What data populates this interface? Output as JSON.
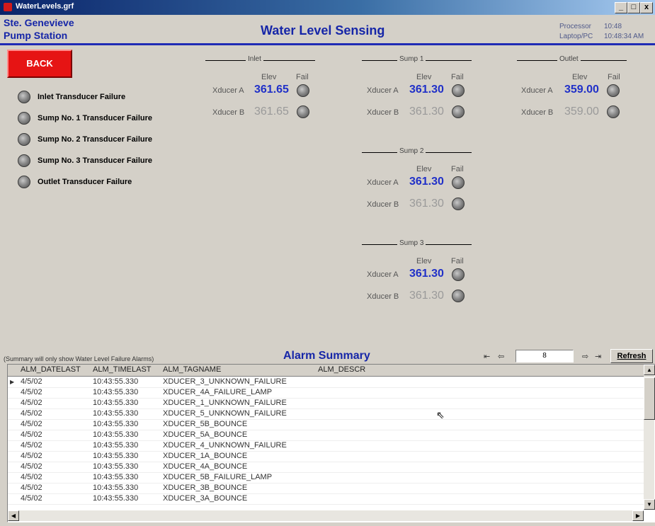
{
  "window": {
    "title": "WaterLevels.grf",
    "minimize": "_",
    "restore": "□",
    "close": "x"
  },
  "header": {
    "station_line1": "Ste. Genevieve",
    "station_line2": "Pump Station",
    "title": "Water Level Sensing",
    "processor_label": "Processor",
    "processor_value": "10:48",
    "laptop_label": "Laptop/PC",
    "laptop_value": "10:48:34 AM"
  },
  "back_label": "BACK",
  "failures": [
    {
      "label": "Inlet Transducer Failure"
    },
    {
      "label": "Sump No. 1 Transducer Failure"
    },
    {
      "label": "Sump No. 2 Transducer Failure"
    },
    {
      "label": "Sump No. 3 Transducer Failure"
    },
    {
      "label": "Outlet Transducer Failure"
    }
  ],
  "column_labels": {
    "elev": "Elev",
    "fail": "Fail",
    "xducer_a": "Xducer A",
    "xducer_b": "Xducer B"
  },
  "stations": {
    "inlet": {
      "name": "Inlet",
      "a": "361.65",
      "b": "361.65"
    },
    "sump1": {
      "name": "Sump 1",
      "a": "361.30",
      "b": "361.30"
    },
    "outlet": {
      "name": "Outlet",
      "a": "359.00",
      "b": "359.00"
    },
    "sump2": {
      "name": "Sump 2",
      "a": "361.30",
      "b": "361.30"
    },
    "sump3": {
      "name": "Sump 3",
      "a": "361.30",
      "b": "361.30"
    }
  },
  "alarm": {
    "note": "(Summary will only show Water Level Failure Alarms)",
    "title": "Alarm Summary",
    "record_number": "8",
    "refresh_label": "Refresh",
    "columns": [
      "ALM_DATELAST",
      "ALM_TIMELAST",
      "ALM_TAGNAME",
      "ALM_DESCR"
    ],
    "rows": [
      [
        "4/5/02",
        "10:43:55.330",
        "XDUCER_3_UNKNOWN_FAILURE",
        ""
      ],
      [
        "4/5/02",
        "10:43:55.330",
        "XDUCER_4A_FAILURE_LAMP",
        ""
      ],
      [
        "4/5/02",
        "10:43:55.330",
        "XDUCER_1_UNKNOWN_FAILURE",
        ""
      ],
      [
        "4/5/02",
        "10:43:55.330",
        "XDUCER_5_UNKNOWN_FAILURE",
        ""
      ],
      [
        "4/5/02",
        "10:43:55.330",
        "XDUCER_5B_BOUNCE",
        ""
      ],
      [
        "4/5/02",
        "10:43:55.330",
        "XDUCER_5A_BOUNCE",
        ""
      ],
      [
        "4/5/02",
        "10:43:55.330",
        "XDUCER_4_UNKNOWN_FAILURE",
        ""
      ],
      [
        "4/5/02",
        "10:43:55.330",
        "XDUCER_1A_BOUNCE",
        ""
      ],
      [
        "4/5/02",
        "10:43:55.330",
        "XDUCER_4A_BOUNCE",
        ""
      ],
      [
        "4/5/02",
        "10:43:55.330",
        "XDUCER_5B_FAILURE_LAMP",
        ""
      ],
      [
        "4/5/02",
        "10:43:55.330",
        "XDUCER_3B_BOUNCE",
        ""
      ],
      [
        "4/5/02",
        "10:43:55.330",
        "XDUCER_3A_BOUNCE",
        ""
      ]
    ]
  },
  "colors": {
    "title_blue": "#1626a8",
    "value_blue": "#2030c8",
    "back_red": "#e61414"
  }
}
